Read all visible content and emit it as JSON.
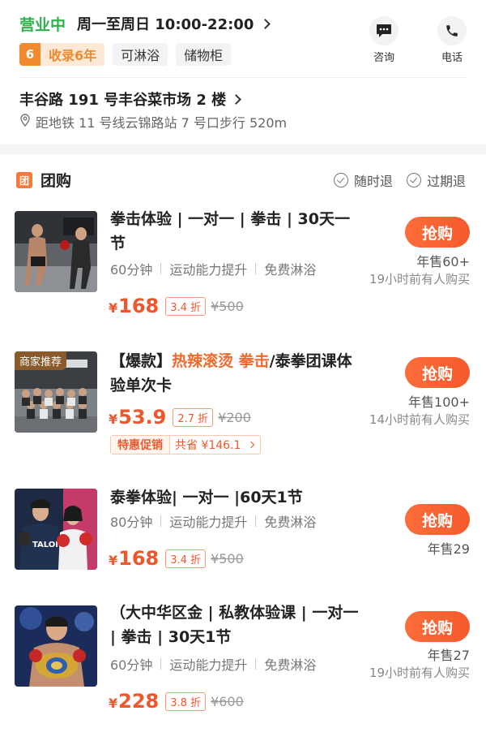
{
  "status": {
    "open_label": "营业中",
    "hours": "周一至周日 10:00-22:00"
  },
  "tags": {
    "years_num": "6",
    "years_label": "收录6年",
    "shower": "可淋浴",
    "locker": "储物柜"
  },
  "contact": {
    "consult_label": "咨询",
    "phone_label": "电话"
  },
  "address": {
    "street": "丰谷路 191 号丰谷菜市场 2 楼",
    "subway": "距地铁 11 号线云锦路站 7 号口步行 520m"
  },
  "group_buy": {
    "badge": "团",
    "title": "团购",
    "policy_anytime": "随时退",
    "policy_expire": "过期退"
  },
  "items": [
    {
      "title": "拳击体验 | 一对一 | 拳击 | 30天一节",
      "duration": "60分钟",
      "benefit": "运动能力提升",
      "shower": "免费淋浴",
      "yen": "¥",
      "price": "168",
      "discount": "3.4 折",
      "original": "¥500",
      "buy_label": "抢购",
      "sales": "年售60+",
      "recent": "19小时前有人购买"
    },
    {
      "thumb_label": "商家推荐",
      "title_prefix": "【爆款】",
      "title_hot": "热辣滚烫 拳击",
      "title_suffix": "/泰拳团课体验单次卡",
      "yen": "¥",
      "price": "53.9",
      "discount": "2.7 折",
      "original": "¥200",
      "promo_tag": "特惠促销",
      "promo_saving": "共省 ¥146.1",
      "buy_label": "抢购",
      "sales": "年售100+",
      "recent": "14小时前有人购买"
    },
    {
      "title": "泰拳体验| 一对一 |60天1节",
      "duration": "80分钟",
      "benefit": "运动能力提升",
      "shower": "免费淋浴",
      "yen": "¥",
      "price": "168",
      "discount": "3.4 折",
      "original": "¥500",
      "buy_label": "抢购",
      "sales": "年售29"
    },
    {
      "title": "（大中华区金 | 私教体验课 | 一对一 | 拳击 | 30天1节",
      "duration": "60分钟",
      "benefit": "运动能力提升",
      "shower": "免费淋浴",
      "yen": "¥",
      "price": "228",
      "discount": "3.8 折",
      "original": "¥600",
      "buy_label": "抢购",
      "sales": "年售27",
      "recent": "19小时前有人购买"
    }
  ],
  "colors": {
    "open_green": "#2bb24c",
    "accent_orange": "#f0562b",
    "button_orange": "#f55a2c"
  }
}
